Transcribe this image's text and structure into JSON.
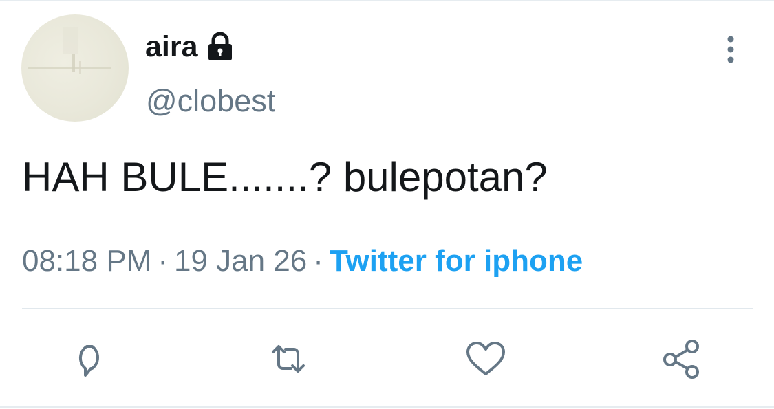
{
  "tweet": {
    "author": {
      "display_name": "aira",
      "handle": "@clobest",
      "protected": true,
      "avatar_icon": "avatar-photo"
    },
    "text": "HAH BULE.......? bulepotan?",
    "meta": {
      "time": "08:18 PM",
      "separator": "·",
      "date": "19 Jan 26",
      "source": "Twitter for iphone"
    },
    "actions": [
      {
        "name": "reply",
        "icon": "reply-icon"
      },
      {
        "name": "retweet",
        "icon": "retweet-icon"
      },
      {
        "name": "like",
        "icon": "heart-icon"
      },
      {
        "name": "share",
        "icon": "share-icon"
      }
    ]
  },
  "colors": {
    "text_primary": "#14171a",
    "text_secondary": "#657786",
    "link_blue": "#1da1f2",
    "divider": "#e1e8ed",
    "icon_gray": "#657786"
  }
}
